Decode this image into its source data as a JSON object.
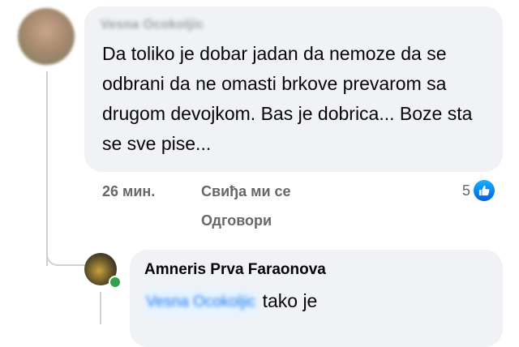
{
  "main_comment": {
    "author": "Vesna Ocokoljic",
    "text": "Da toliko je dobar jadan da nemoze da se odbrani da ne omasti brkove prevarom sa drugom devojkom. Bas je dobrica... Boze sta se sve pise...",
    "time": "26 мин.",
    "like_label": "Свиђа ми се",
    "reply_label": "Одговори",
    "reaction_count": "5"
  },
  "reply": {
    "author": "Amneris Prva Faraonova",
    "mention": "Vesna Ocokoljic",
    "text": "tako je"
  },
  "colors": {
    "bubble": "#f0f2f5",
    "meta": "#65676b",
    "like_blue": "#0062df",
    "online": "#31a24c"
  }
}
